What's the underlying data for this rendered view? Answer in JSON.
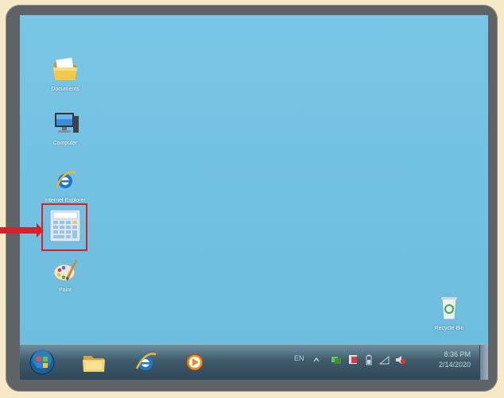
{
  "desktop": {
    "icons": [
      {
        "label": "Documents",
        "icon": "documents-folder-icon"
      },
      {
        "label": "Computer",
        "icon": "computer-icon"
      },
      {
        "label": "Internet Explorer",
        "icon": "internet-explorer-icon"
      },
      {
        "label": "",
        "icon": "calculator-icon"
      },
      {
        "label": "Paint",
        "icon": "paint-icon"
      },
      {
        "label": "Recycle Bin",
        "icon": "recycle-bin-icon"
      }
    ]
  },
  "taskbar": {
    "buttons": [
      {
        "icon": "start-orb-icon"
      },
      {
        "icon": "explorer-folder-icon"
      },
      {
        "icon": "internet-explorer-icon"
      },
      {
        "icon": "media-player-icon"
      }
    ],
    "tray": {
      "language": "EN",
      "icons": [
        "chevron-up-icon",
        "network-icon",
        "flag-icon",
        "battery-icon",
        "signal-icon",
        "volume-icon"
      ]
    },
    "clock": {
      "time": "8:36 PM",
      "date": "2/14/2020"
    }
  },
  "colors": {
    "desktop": "#6fbfe0",
    "highlight": "#d3232a",
    "frame": "#5f6366"
  }
}
